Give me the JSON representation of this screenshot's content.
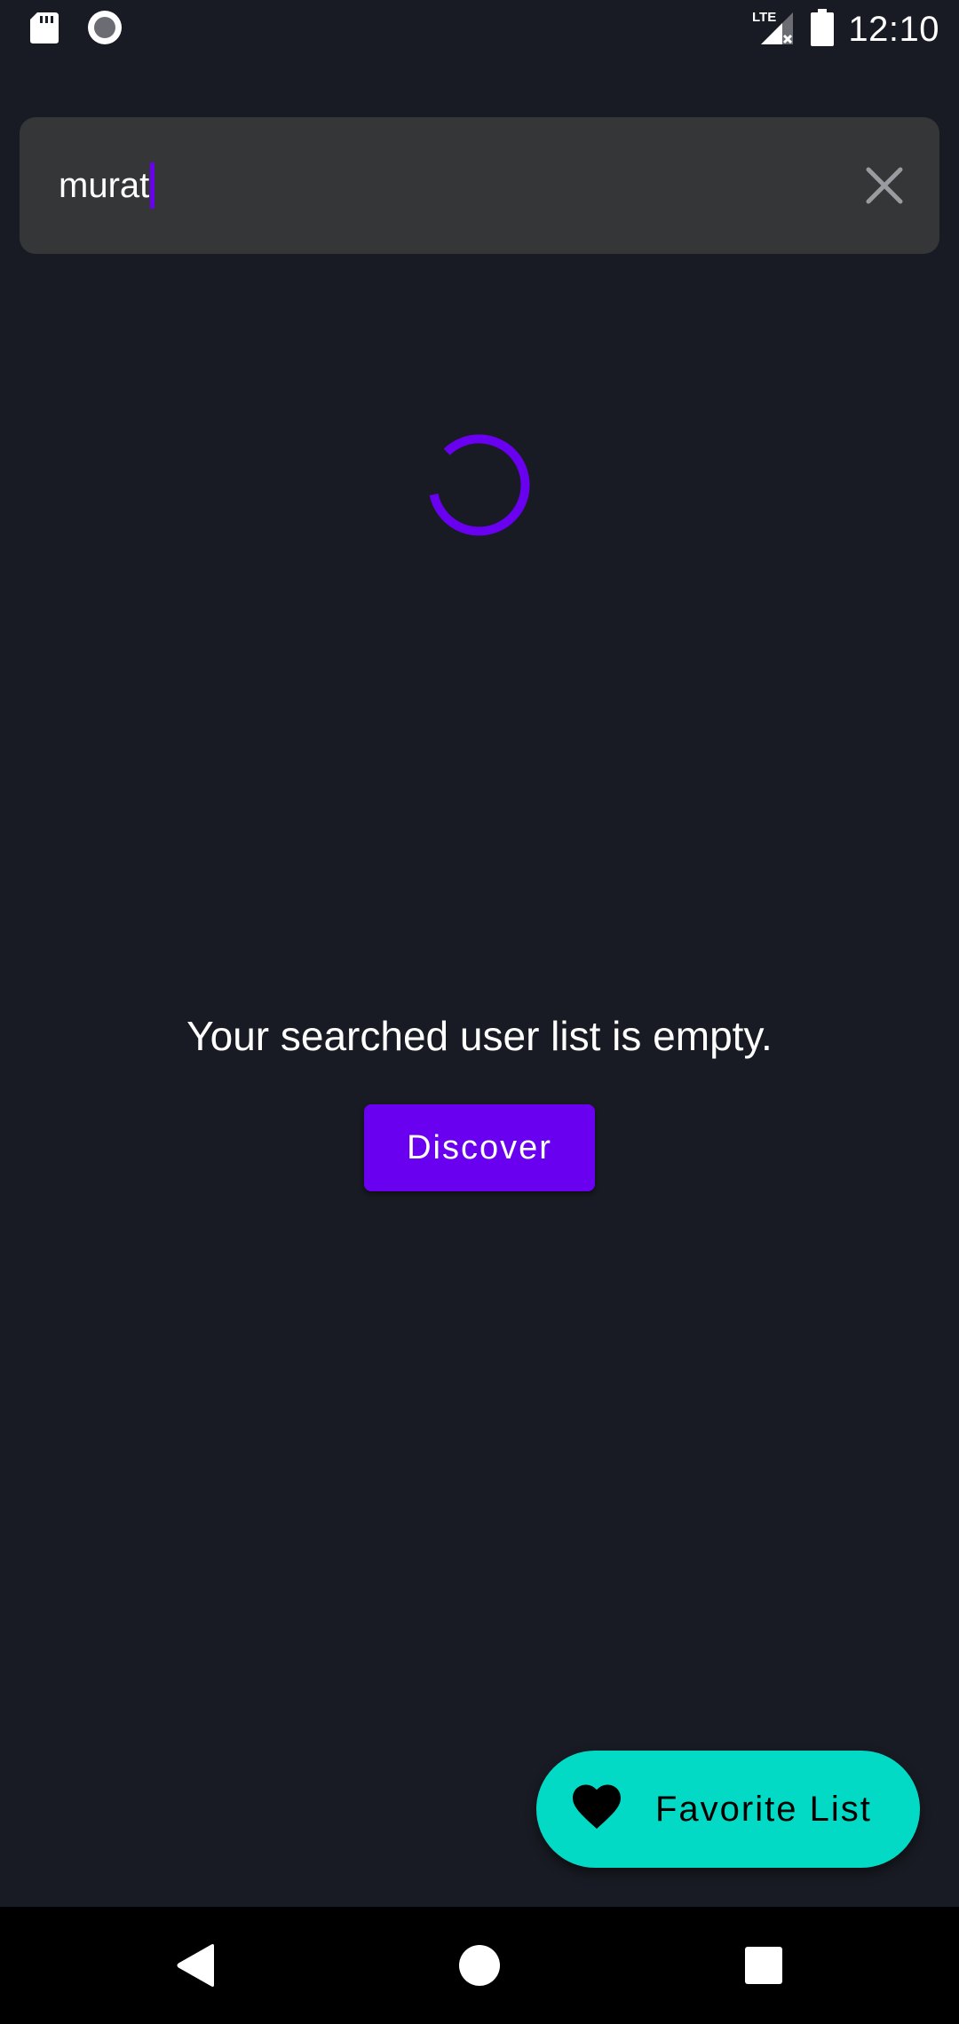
{
  "status_bar": {
    "time": "12:10",
    "network": "LTE",
    "icons": [
      "sd-card-icon",
      "record-icon",
      "lte-signal-icon",
      "battery-icon"
    ]
  },
  "search": {
    "value": "murat",
    "clear_icon": "close-icon"
  },
  "loading": {
    "icon": "progress-spinner-icon",
    "color": "#6a00f0"
  },
  "empty_state": {
    "message": "Your searched user list is empty.",
    "button_label": "Discover"
  },
  "fab": {
    "icon": "heart-icon",
    "label": "Favorite List"
  },
  "nav_bar": {
    "icons": [
      "back-icon",
      "home-icon",
      "recents-icon"
    ]
  },
  "colors": {
    "background": "#181b23",
    "search_bar": "#353638",
    "accent": "#6a00f0",
    "fab": "#03dac5"
  }
}
